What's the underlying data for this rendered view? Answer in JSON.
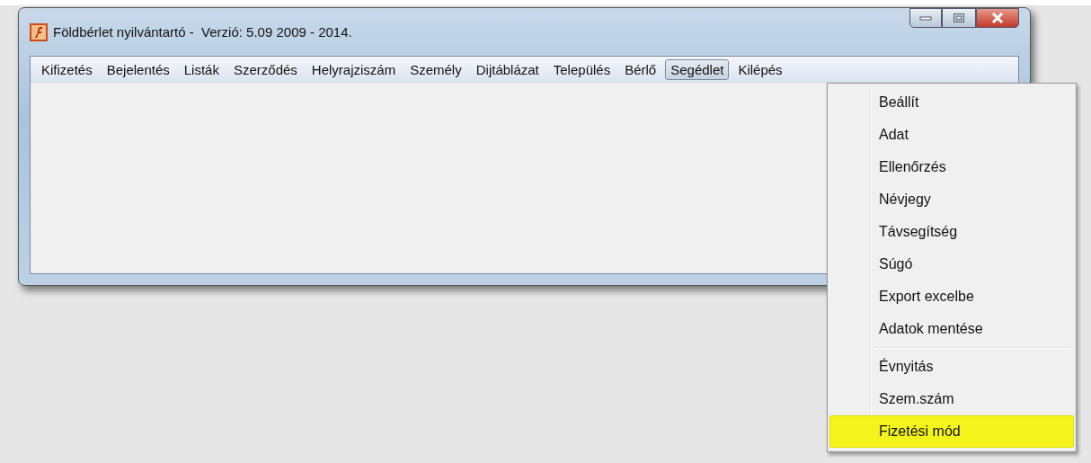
{
  "window": {
    "title": "Földbérlet nyilvántartó -  Verzió: 5.09 2009 - 2014."
  },
  "menu_bar": [
    {
      "label": "Kifizetés",
      "selected": false
    },
    {
      "label": "Bejelentés",
      "selected": false
    },
    {
      "label": "Listák",
      "selected": false
    },
    {
      "label": "Szerződés",
      "selected": false
    },
    {
      "label": "Helyrajziszám",
      "selected": false
    },
    {
      "label": "Személy",
      "selected": false
    },
    {
      "label": "Dijtáblázat",
      "selected": false
    },
    {
      "label": "Település",
      "selected": false
    },
    {
      "label": "Bérlő",
      "selected": false
    },
    {
      "label": "Segédlet",
      "selected": true
    },
    {
      "label": "Kilépés",
      "selected": false
    }
  ],
  "dropdown_menu": {
    "groups": [
      {
        "items": [
          {
            "label": "Beállít",
            "selected": false
          },
          {
            "label": "Adat",
            "selected": false
          },
          {
            "label": "Ellenőrzés",
            "selected": false
          },
          {
            "label": "Névjegy",
            "selected": false
          },
          {
            "label": "Távsegítség",
            "selected": false
          },
          {
            "label": "Súgó",
            "selected": false
          },
          {
            "label": "Export excelbe",
            "selected": false
          },
          {
            "label": "Adatok mentése",
            "selected": false
          }
        ]
      },
      {
        "items": [
          {
            "label": "Évnyitás",
            "selected": false
          },
          {
            "label": "Szem.szám",
            "selected": false
          },
          {
            "label": "Fizetési mód",
            "selected": true
          }
        ]
      }
    ]
  }
}
